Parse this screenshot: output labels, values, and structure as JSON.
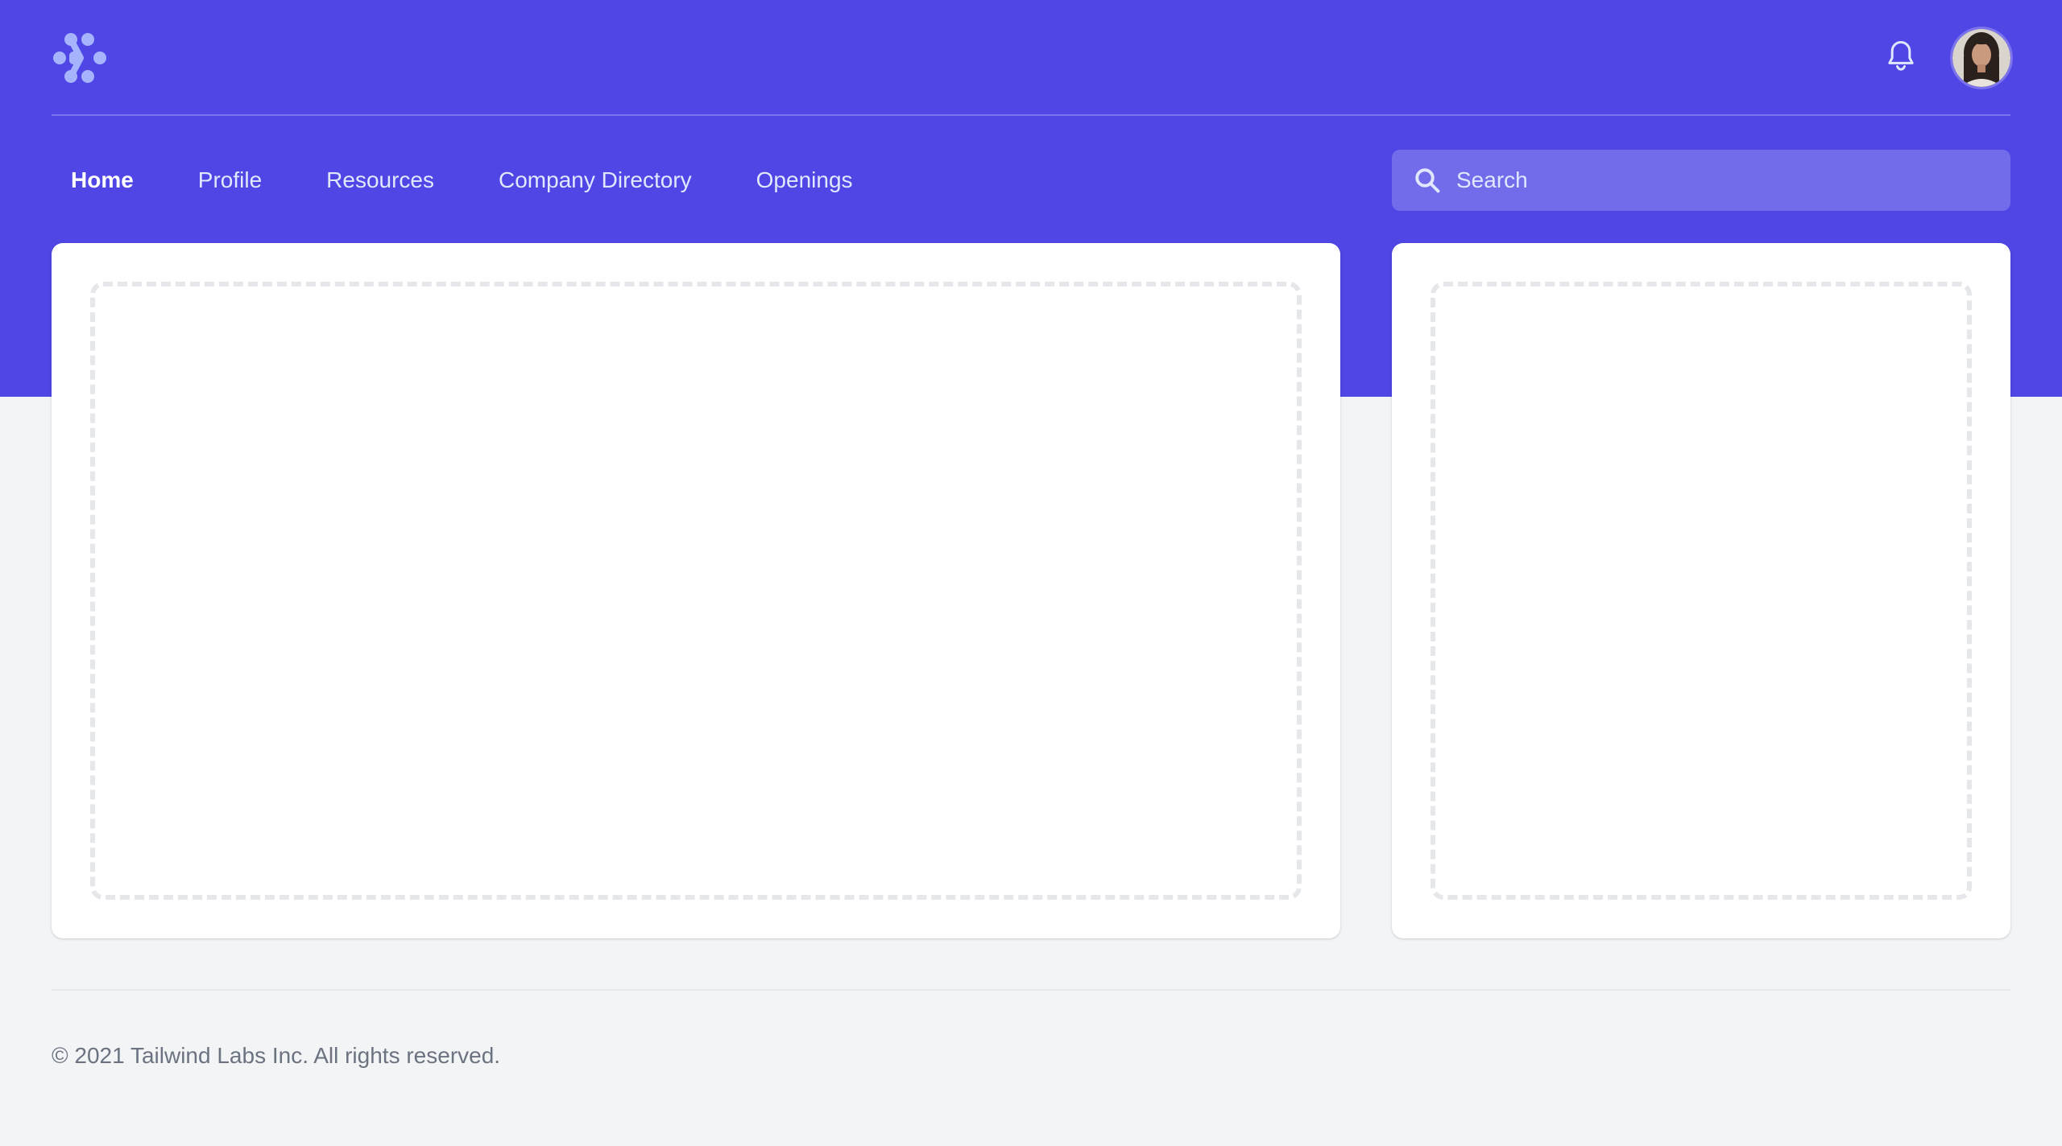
{
  "colors": {
    "brand": "#4f46e5",
    "logo": "#a5b4fc",
    "page_bg": "#f3f4f6",
    "placeholder_border": "#e5e7eb"
  },
  "header": {
    "logo_icon": "workflow-logo-icon",
    "notifications_icon": "bell-icon",
    "avatar_icon": "user-avatar"
  },
  "nav": {
    "items": [
      {
        "label": "Home",
        "active": true
      },
      {
        "label": "Profile",
        "active": false
      },
      {
        "label": "Resources",
        "active": false
      },
      {
        "label": "Company Directory",
        "active": false
      },
      {
        "label": "Openings",
        "active": false
      }
    ]
  },
  "search": {
    "placeholder": "Search",
    "value": "",
    "icon": "search-icon"
  },
  "footer": {
    "copyright": "© 2021 Tailwind Labs Inc. All rights reserved."
  }
}
